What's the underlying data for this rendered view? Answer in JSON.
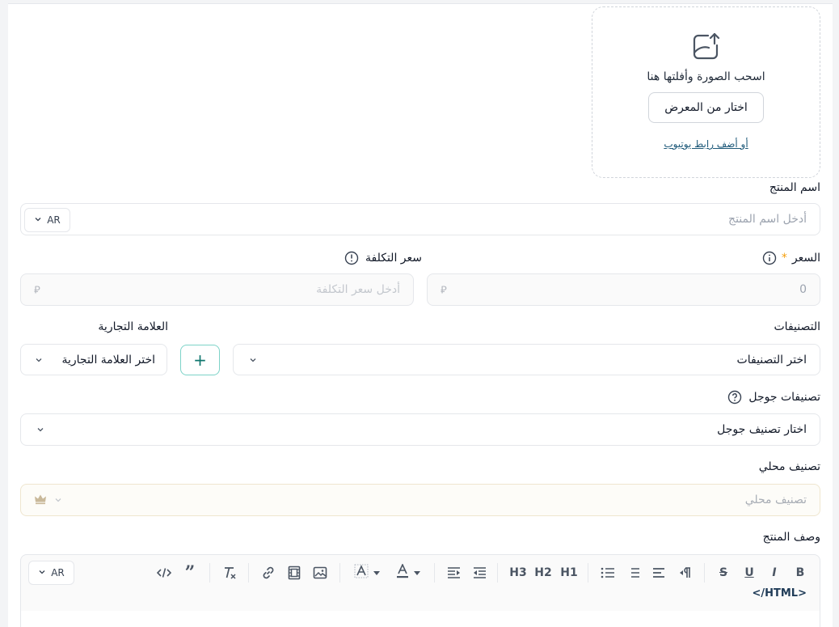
{
  "upload": {
    "drag_text": "اسحب الصورة وأفلتها هنا",
    "gallery_button": "اختار من المعرض",
    "youtube_link": "أو أضف رابط يوتيوب"
  },
  "product_name": {
    "label": "اسم المنتج",
    "placeholder": "أدخل اسم المنتج",
    "lang": "AR"
  },
  "price": {
    "label": "السعر",
    "required_mark": "*",
    "value": "0",
    "currency_icon": "sar-icon"
  },
  "cost_price": {
    "label": "سعر التكلفة",
    "placeholder": "أدخل سعر التكلفة",
    "currency_icon": "sar-icon"
  },
  "categories": {
    "label": "التصنيفات",
    "selected": "اختر التصنيفات"
  },
  "brand": {
    "label": "العلامة التجارية",
    "selected": "اختر العلامة التجارية",
    "add_label": "+"
  },
  "google_categories": {
    "label": "تصنيفات جوجل",
    "selected": "اختار تصنيف جوجل"
  },
  "local_category": {
    "label": "تصنيف محلي",
    "placeholder": "تصنيف محلي"
  },
  "description": {
    "label": "وصف المنتج",
    "lang": "AR",
    "html_label": "</HTML>",
    "toolbar": {
      "bold": "B",
      "italic": "I",
      "underline": "U",
      "strike": "S",
      "h1": "H1",
      "h2": "H2",
      "h3": "H3"
    }
  },
  "colors": {
    "accent": "#0f766e",
    "add_border": "#7dd3c8",
    "border": "#e5e7eb",
    "placeholder": "#9ca3af",
    "required": "#f59e0b"
  }
}
